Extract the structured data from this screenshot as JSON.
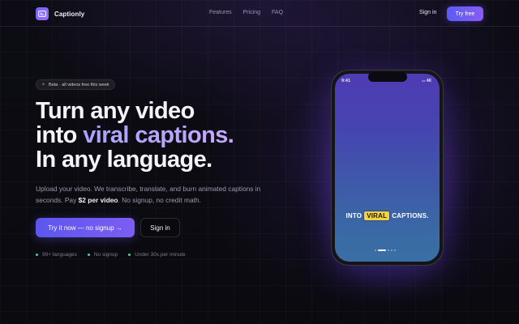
{
  "nav": {
    "brand": "Captionly",
    "links": [
      "Features",
      "Pricing",
      "FAQ"
    ],
    "signin": "Sign in",
    "cta": "Try free"
  },
  "hero": {
    "badge_icon": "sparkle-icon",
    "badge": "Beta · all videos free this week",
    "headline_line1": "Turn any video",
    "headline_line2_prefix": "into ",
    "headline_line2_accent": "viral captions.",
    "headline_line3": "In any language.",
    "sub_part1": "Upload your video. We transcribe, translate, and burn animated captions in seconds. Pay ",
    "sub_price": "$2 per video",
    "sub_part2": ". No signup, no credit math.",
    "cta_primary": "Try it now — no signup →",
    "cta_secondary": "Sign in",
    "features": [
      "99+ languages",
      "No signup",
      "Under 30s per minute"
    ]
  },
  "phone": {
    "time": "9:41",
    "status_right": "⚏ 4K",
    "caption_before": "INTO",
    "caption_highlight": "VIRAL",
    "caption_after": "CAPTIONS.",
    "pager_count": 5,
    "pager_active": 1
  },
  "colors": {
    "accent": "#6f63ff",
    "highlight": "#f3d13f",
    "feature_dot": "#3fd39a"
  }
}
